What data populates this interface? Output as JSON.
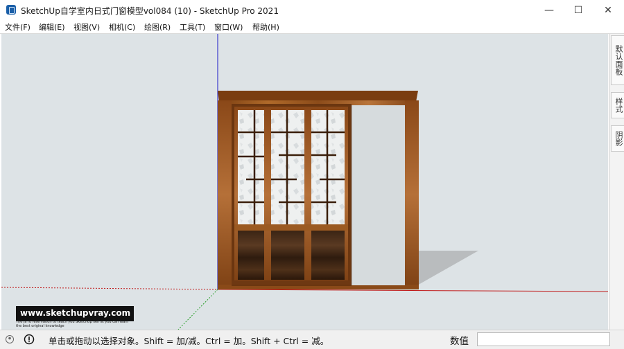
{
  "window": {
    "title": "SketchUp自学室内日式门窗模型vol084 (10) - SketchUp Pro 2021",
    "minimize_glyph": "—",
    "maximize_glyph": "☐",
    "close_glyph": "✕"
  },
  "menu": [
    {
      "label": "文件(F)"
    },
    {
      "label": "编辑(E)"
    },
    {
      "label": "视图(V)"
    },
    {
      "label": "相机(C)"
    },
    {
      "label": "绘图(R)"
    },
    {
      "label": "工具(T)"
    },
    {
      "label": "窗口(W)"
    },
    {
      "label": "帮助(H)"
    }
  ],
  "tray": {
    "tabs": [
      {
        "label": "默认面板"
      },
      {
        "label": "样式"
      },
      {
        "label": "阴影"
      }
    ]
  },
  "watermark": {
    "title": "www.sketchupvray.com",
    "subtitle": "The Ja ro rese vation to teach you SketchUp self at you can learn\nthe best original knowledge"
  },
  "status": {
    "message": "单击或拖动以选择对象。Shift = 加/减。Ctrl = 加。Shift + Ctrl = 减。",
    "measurements_label": "数值",
    "measurements_value": ""
  },
  "colors": {
    "background": "#dde3e6",
    "wood": "#9a5a1f",
    "axis_red": "#c01818",
    "axis_green": "#2aa02a",
    "axis_blue": "#1a1ac8"
  }
}
